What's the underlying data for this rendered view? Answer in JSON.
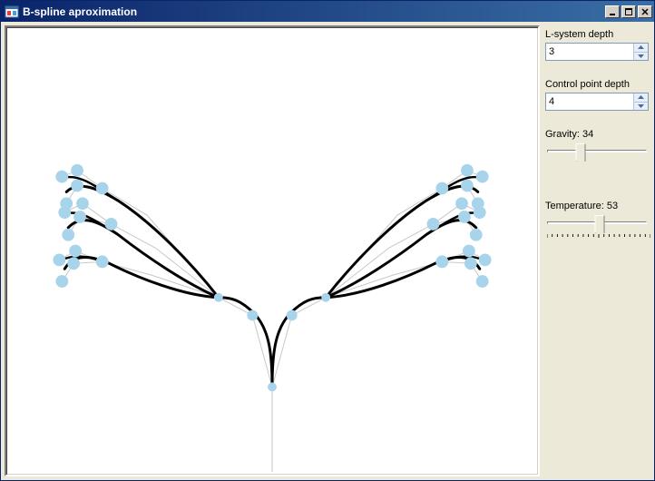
{
  "window": {
    "title": "B-spline aproximation"
  },
  "controls": {
    "lsystem": {
      "label": "L-system depth",
      "value": "3"
    },
    "control_point": {
      "label": "Control point depth",
      "value": "4"
    },
    "gravity": {
      "label": "Gravity: 34",
      "value": 34,
      "min": 0,
      "max": 100
    },
    "temperature": {
      "label": "Temperature: 53",
      "value": 53,
      "min": 0,
      "max": 100
    }
  },
  "colors": {
    "control_point": "#a7d4ea",
    "curve": "#000000",
    "polyline": "#c7c7c7"
  }
}
